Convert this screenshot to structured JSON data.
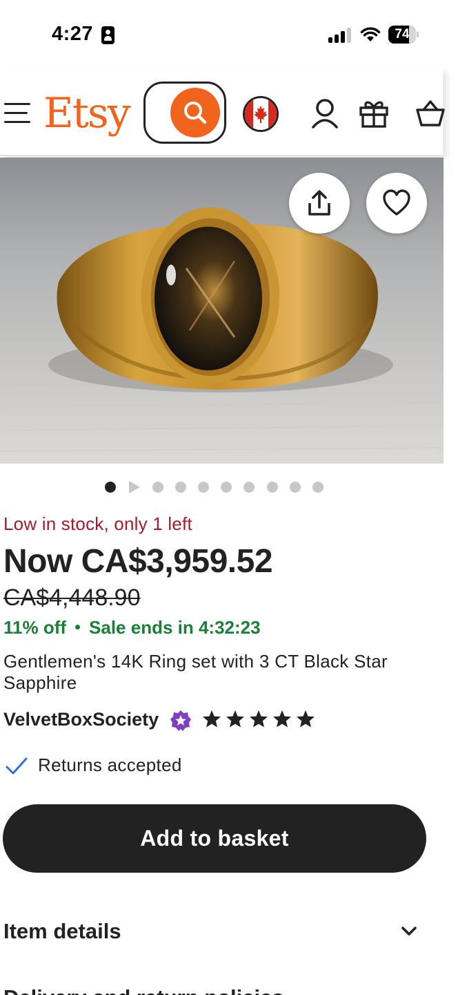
{
  "status_bar": {
    "time": "4:27",
    "battery_level": "74"
  },
  "header": {
    "logo_text": "Etsy",
    "colors": {
      "brand": "#f1641e"
    }
  },
  "hero": {
    "image_alt": "Gold ring with black star sapphire",
    "carousel_total": 10,
    "carousel_active_index": 0
  },
  "product": {
    "stock_text": "Low in stock, only 1 left",
    "price_now": "Now CA$3,959.52",
    "price_original": "CA$4,448.90",
    "discount": "11% off",
    "sale_timer": "Sale ends in 4:32:23",
    "title": "Gentlemen's 14K Ring set with 3 CT Black Star Sapphire",
    "shop_name": "VelvetBoxSociety",
    "rating_stars": 5,
    "returns_text": "Returns accepted",
    "add_button_label": "Add to basket",
    "item_details_label": "Item details",
    "next_section_label": "Delivery and return policies"
  },
  "colors": {
    "stock_red": "#a61a2e",
    "sale_green": "#1a7f37",
    "star_seller_purple": "#7f3fbf",
    "check_blue": "#2f6fde"
  }
}
